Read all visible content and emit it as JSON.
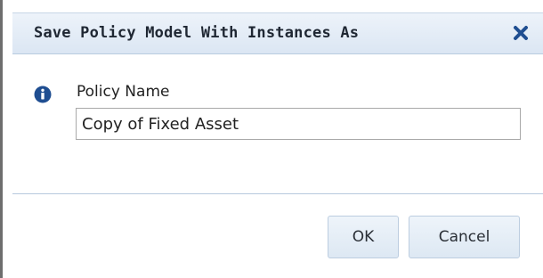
{
  "dialog": {
    "title": "Save Policy Model With Instances As",
    "close_icon": "close-icon"
  },
  "form": {
    "info_icon": "info-icon",
    "label": "Policy Name",
    "value": "Copy of Fixed Asset"
  },
  "buttons": {
    "ok_label": "OK",
    "cancel_label": "Cancel"
  },
  "colors": {
    "title_bar": "#dbe6f3",
    "icon_blue": "#1f4e91",
    "button_bg": "#e6eef7"
  }
}
